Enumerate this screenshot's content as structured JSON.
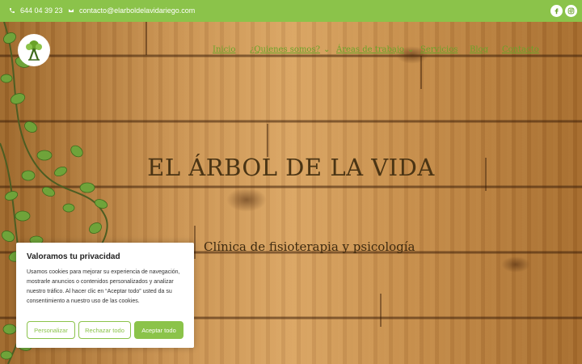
{
  "topbar": {
    "phone": "644 04 39 23",
    "email": "contacto@elarboldelavidariego.com",
    "social": [
      "facebook-icon",
      "instagram-icon"
    ]
  },
  "nav": {
    "items": [
      {
        "label": "Inicio",
        "dropdown": false
      },
      {
        "label": "¿Quienes somos?",
        "dropdown": true
      },
      {
        "label": "Áreas de trabajo",
        "dropdown": true
      },
      {
        "label": "Servicios",
        "dropdown": false
      },
      {
        "label": "Blog",
        "dropdown": false
      },
      {
        "label": "Contacto",
        "dropdown": false
      }
    ]
  },
  "hero": {
    "title": "EL ÁRBOL DE LA VIDA",
    "subtitle": "Clínica de fisioterapia y psicología"
  },
  "cookie": {
    "title": "Valoramos tu privacidad",
    "body": "Usamos cookies para mejorar su experiencia de navegación, mostrarle anuncios o contenidos personalizados y analizar nuestro tráfico. Al hacer clic en “Aceptar todo” usted da su consentimiento a nuestro uso de las cookies.",
    "customize": "Personalizar",
    "reject": "Rechazar todo",
    "accept": "Aceptar todo"
  },
  "colors": {
    "accent": "#8bc34a",
    "nav_link": "#6aa228",
    "title": "#4a3414"
  }
}
